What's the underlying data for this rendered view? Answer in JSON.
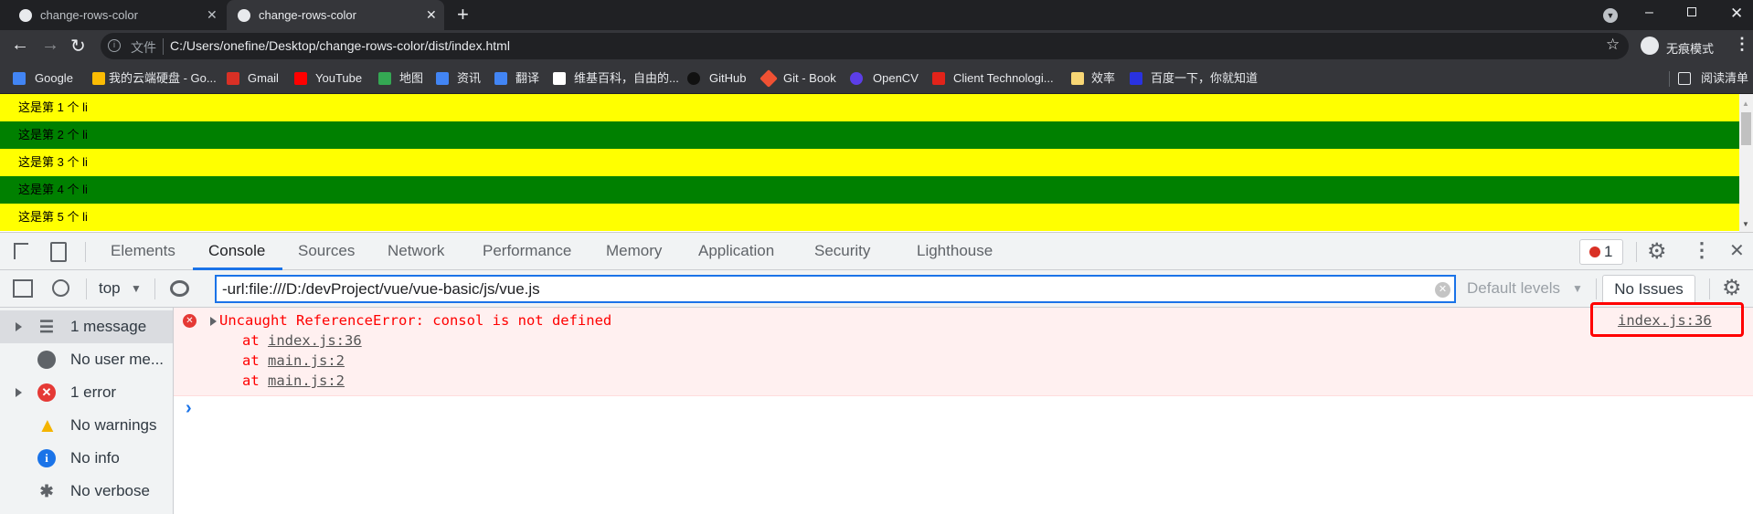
{
  "browser": {
    "tabs": [
      {
        "title": "change-rows-color",
        "active": false
      },
      {
        "title": "change-rows-color",
        "active": true
      }
    ],
    "new_tab": "+",
    "address": {
      "security_label": "文件",
      "url": "C:/Users/onefine/Desktop/change-rows-color/dist/index.html"
    },
    "incognito_label": "无痕模式",
    "bookmarks": [
      {
        "label": "Google",
        "icon": "google-icon",
        "color": "#4285f4"
      },
      {
        "label": "我的云端硬盘 - Go...",
        "icon": "drive-icon",
        "color": "#fbbc04"
      },
      {
        "label": "Gmail",
        "icon": "gmail-icon",
        "color": "#d93025"
      },
      {
        "label": "YouTube",
        "icon": "youtube-icon",
        "color": "#ff0000"
      },
      {
        "label": "地图",
        "icon": "maps-icon",
        "color": "#34a853"
      },
      {
        "label": "资讯",
        "icon": "news-icon",
        "color": "#4285f4"
      },
      {
        "label": "翻译",
        "icon": "translate-icon",
        "color": "#4285f4"
      },
      {
        "label": "维基百科，自由的...",
        "icon": "wikipedia-icon",
        "color": "#ffffff"
      },
      {
        "label": "GitHub",
        "icon": "github-icon",
        "color": "#000000"
      },
      {
        "label": "Git - Book",
        "icon": "git-icon",
        "color": "#f05133"
      },
      {
        "label": "OpenCV",
        "icon": "opencv-icon",
        "color": "#5c3ee8"
      },
      {
        "label": "Client Technologi...",
        "icon": "oracle-icon",
        "color": "#e2231a"
      },
      {
        "label": "效率",
        "icon": "folder-icon",
        "color": "#f8d775"
      },
      {
        "label": "百度一下，你就知道",
        "icon": "baidu-icon",
        "color": "#2932e1"
      }
    ],
    "reading_list": "阅读清单"
  },
  "page": {
    "rows": [
      {
        "text": "这是第 1 个 li",
        "color": "#ffff00"
      },
      {
        "text": "这是第 2 个 li",
        "color": "#008000"
      },
      {
        "text": "这是第 3 个 li",
        "color": "#ffff00"
      },
      {
        "text": "这是第 4 个 li",
        "color": "#008000"
      },
      {
        "text": "这是第 5 个 li",
        "color": "#ffff00"
      }
    ]
  },
  "devtools": {
    "tabs": [
      "Elements",
      "Console",
      "Sources",
      "Network",
      "Performance",
      "Memory",
      "Application",
      "Security",
      "Lighthouse"
    ],
    "selected_tab": "Console",
    "error_count": "1",
    "context": "top",
    "filter_value": "-url:file:///D:/devProject/vue/vue-basic/js/vue.js",
    "levels": "Default levels",
    "issues": "No Issues",
    "sidebar": [
      {
        "label": "1 message",
        "icon": "list-icon"
      },
      {
        "label": "No user me...",
        "icon": "user-icon"
      },
      {
        "label": "1 error",
        "icon": "error-icon"
      },
      {
        "label": "No warnings",
        "icon": "warning-icon"
      },
      {
        "label": "No info",
        "icon": "info-icon"
      },
      {
        "label": "No verbose",
        "icon": "bug-icon"
      }
    ],
    "error": {
      "message": "Uncaught ReferenceError: consol is not defined",
      "at": "at",
      "stack": [
        "index.js:36",
        "main.js:2",
        "main.js:2"
      ],
      "source": "index.js:36"
    },
    "prompt": "›"
  },
  "annotation_color": "#ff0000"
}
